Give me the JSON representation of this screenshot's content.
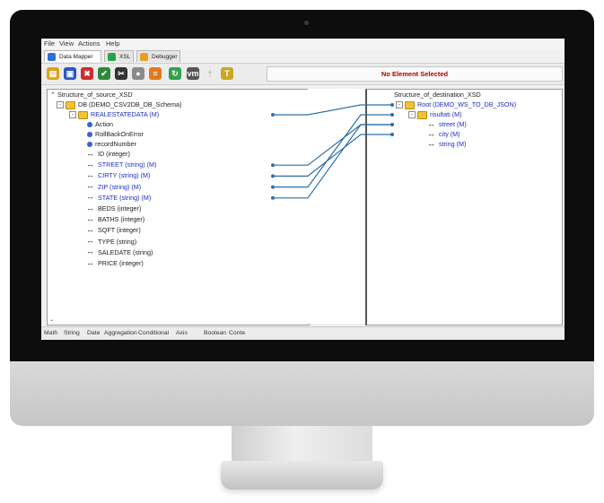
{
  "menu": [
    "File",
    "View",
    "Actions",
    "Help"
  ],
  "tabs": [
    {
      "label": "Data Mapper",
      "color": "#2f6fd6"
    },
    {
      "label": "XSL",
      "color": "#2ea04a"
    },
    {
      "label": "Debugger",
      "color": "#e8a020"
    }
  ],
  "toolbar": {
    "icons": [
      {
        "name": "open-icon",
        "glyph": "▤",
        "color": "#d9a31a"
      },
      {
        "name": "save-icon",
        "glyph": "▣",
        "color": "#2a56c6"
      },
      {
        "name": "delete-icon",
        "glyph": "✖",
        "color": "#d02d2d"
      },
      {
        "name": "validate-icon",
        "glyph": "✔",
        "color": "#2c8a3a"
      },
      {
        "name": "clear-icon",
        "glyph": "✂",
        "color": "#333333"
      },
      {
        "name": "circle-icon",
        "glyph": "●",
        "color": "#8a8a8a"
      },
      {
        "name": "database-icon",
        "glyph": "≡",
        "color": "#e07a1a"
      },
      {
        "name": "refresh-icon",
        "glyph": "↻",
        "color": "#33a04c"
      },
      {
        "name": "vm-icon",
        "glyph": "vm",
        "color": "#555555"
      },
      {
        "name": "pin-icon",
        "glyph": "†",
        "color": "#bbbbbb"
      },
      {
        "name": "text-icon",
        "glyph": "T",
        "color": "#c8a82a"
      }
    ],
    "status": "No Element Selected"
  },
  "source": {
    "root": "Structure_of_source_XSD",
    "db": "DB (DEMO_CSV2DB_DB_Schema)",
    "record": "REALESTATEDATA  (M)",
    "attributes": [
      "Action",
      "RollBackOnError",
      "recordNumber"
    ],
    "fields": [
      {
        "label": "ID  (integer)",
        "mapped": false
      },
      {
        "label": "STREET  (string)  (M)",
        "mapped": true
      },
      {
        "label": "CIRTY  (string)  (M)",
        "mapped": true
      },
      {
        "label": "ZIP  (string)  (M)",
        "mapped": true
      },
      {
        "label": "STATE  (string)  (M)",
        "mapped": true
      },
      {
        "label": "BEDS  (integer)",
        "mapped": false
      },
      {
        "label": "BATHS  (integer)",
        "mapped": false
      },
      {
        "label": "SQFT  (integer)",
        "mapped": false
      },
      {
        "label": "TYPE  (string)",
        "mapped": false
      },
      {
        "label": "SALEDATE  (string)",
        "mapped": false
      },
      {
        "label": "PRICE  (integer)",
        "mapped": false
      }
    ]
  },
  "destination": {
    "root": "Structure_of_destination_XSD",
    "root_node": "Root  (DEMO_WS_TO_DB_JSON)",
    "group": "risultati  (M)",
    "fields": [
      "street  (M)",
      "city  (M)",
      "string  (M)"
    ]
  },
  "functions": [
    "Math",
    "String",
    "Date",
    "Aggregation",
    "Conditional",
    "Axis",
    "Boolean",
    "Conte"
  ],
  "link_color": "#2e6fa8"
}
